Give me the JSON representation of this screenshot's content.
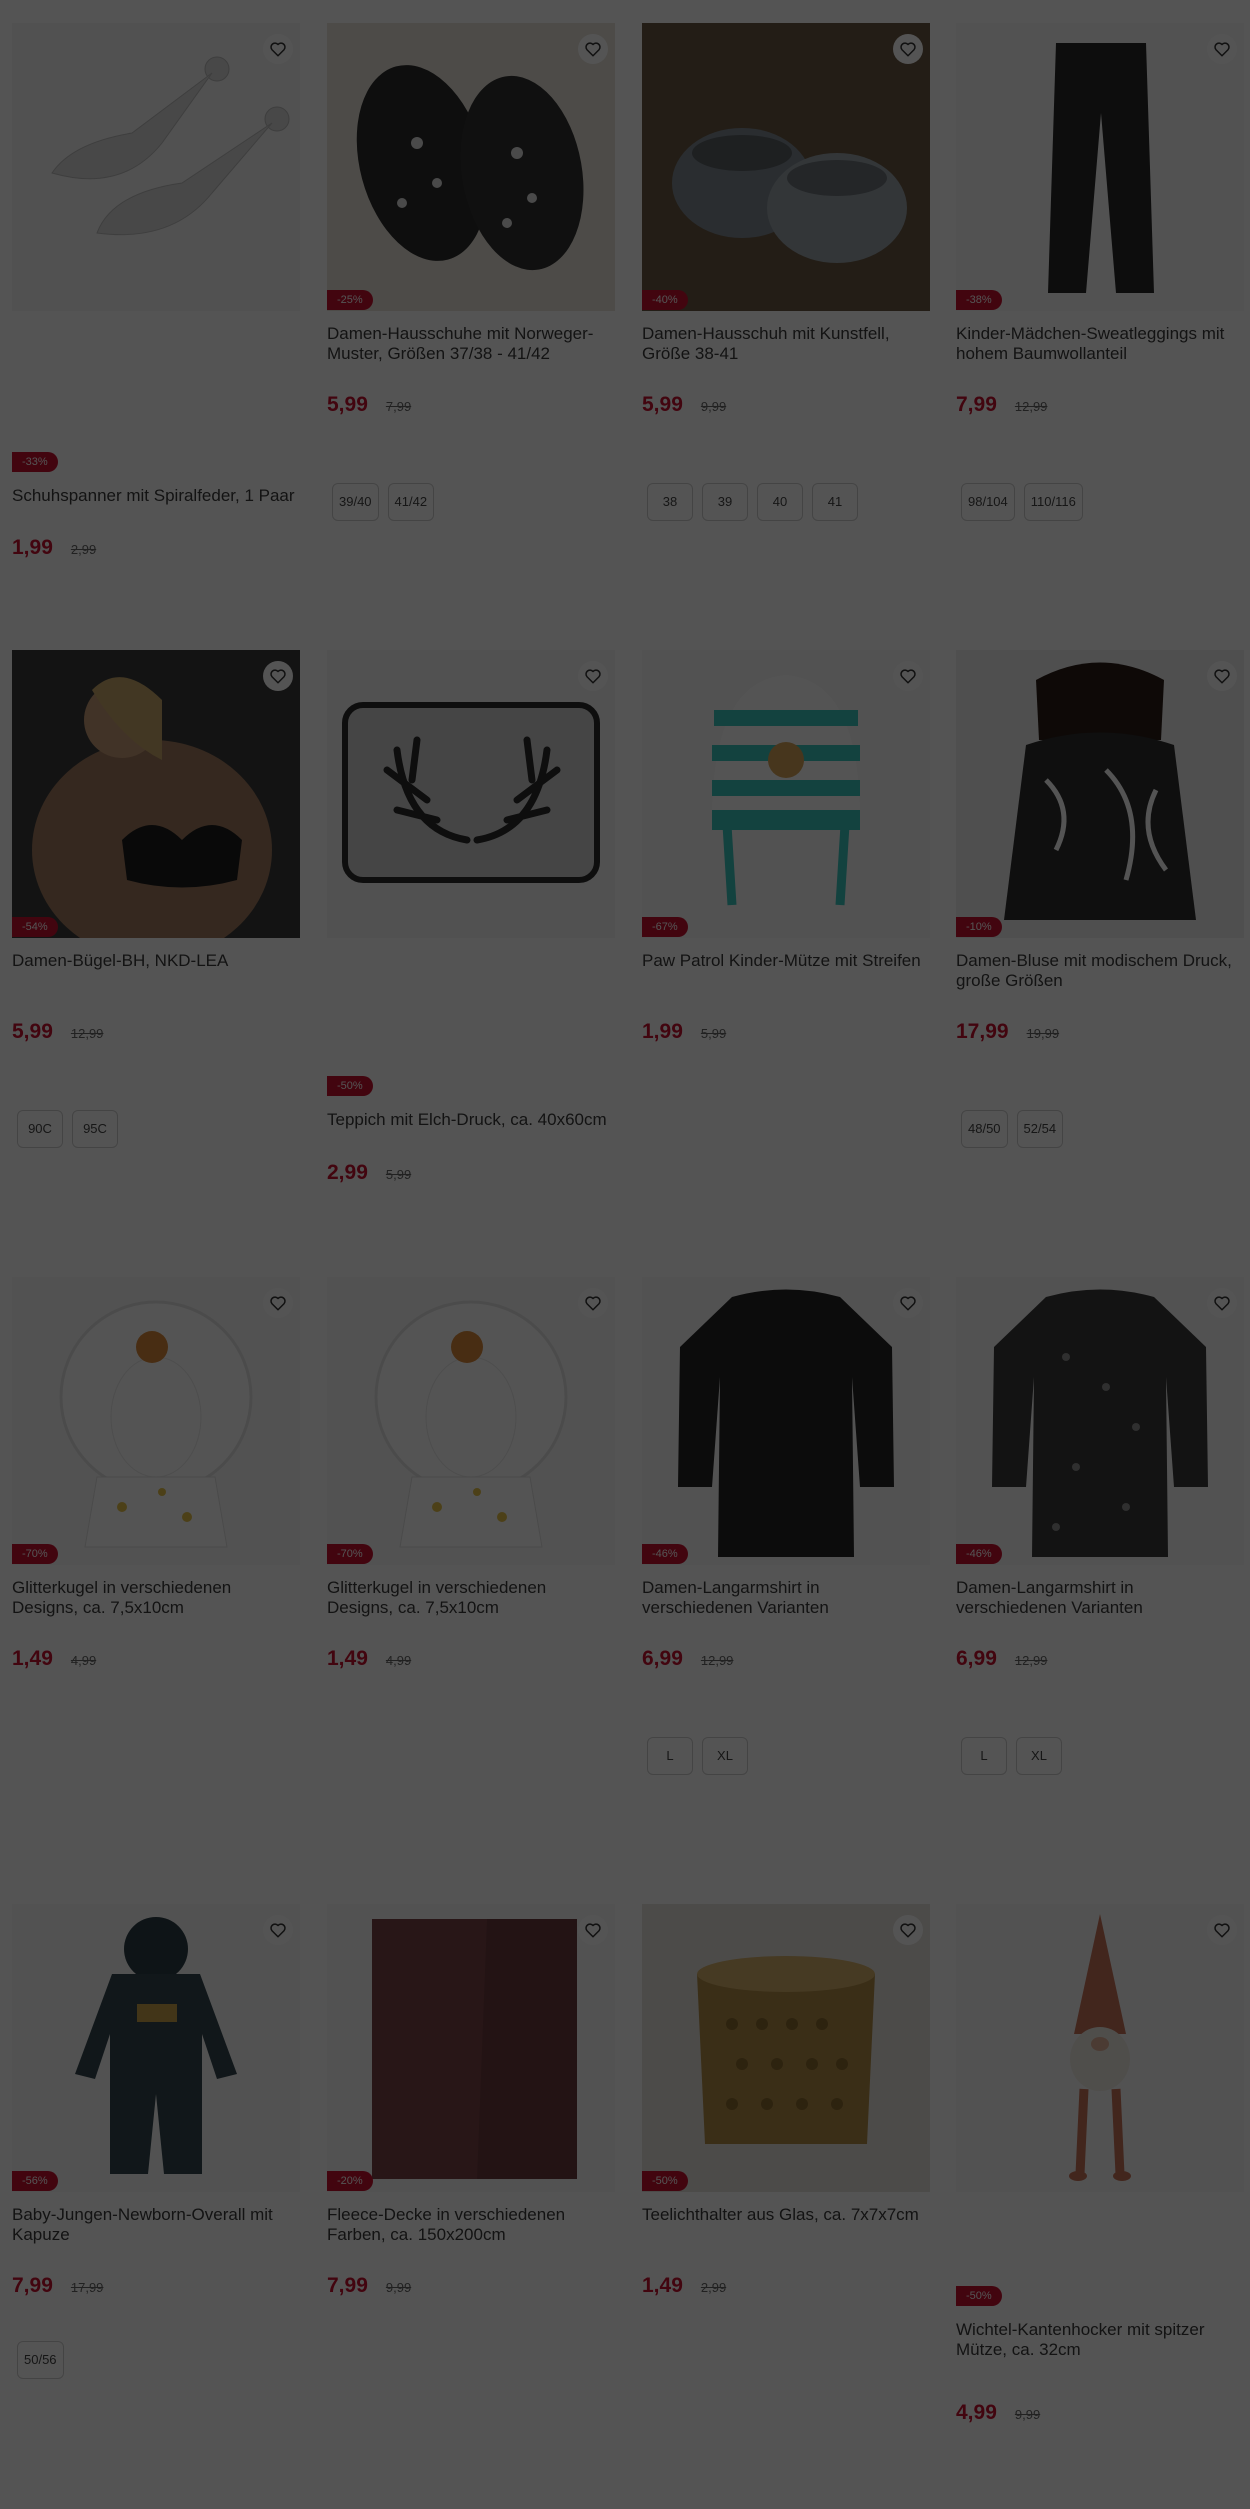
{
  "products": [
    {
      "name": "Schuhspanner mit Spiralfeder, 1 Paar",
      "discount": "-33%",
      "price": "1,99",
      "old_price": "2,99",
      "sizes": [],
      "image": "shoe-stretcher-image"
    },
    {
      "name": "Damen-Hausschuhe mit Norweger-Muster, Größen 37/38 - 41/42",
      "discount": "-25%",
      "price": "5,99",
      "old_price": "7,99",
      "sizes": [
        "39/40",
        "41/42"
      ],
      "image": "norwegian-slippers-image"
    },
    {
      "name": "Damen-Hausschuh mit Kunstfell, Größe 38-41",
      "discount": "-40%",
      "price": "5,99",
      "old_price": "9,99",
      "sizes": [
        "38",
        "39",
        "40",
        "41"
      ],
      "image": "faux-fur-slippers-image"
    },
    {
      "name": "Kinder-Mädchen-Sweatleggings mit hohem Baumwollanteil",
      "discount": "-38%",
      "price": "7,99",
      "old_price": "12,99",
      "sizes": [
        "98/104",
        "110/116"
      ],
      "image": "leggings-image"
    },
    {
      "name": "Damen-Bügel-BH, NKD-LEA",
      "discount": "-54%",
      "price": "5,99",
      "old_price": "12,99",
      "sizes": [
        "90C",
        "95C"
      ],
      "image": "bra-image"
    },
    {
      "name": "Teppich mit Elch-Druck, ca. 40x60cm",
      "discount": "-50%",
      "price": "2,99",
      "old_price": "5,99",
      "sizes": [],
      "image": "antler-rug-image"
    },
    {
      "name": "Paw Patrol Kinder-Mütze mit Streifen",
      "discount": "-67%",
      "price": "1,99",
      "old_price": "5,99",
      "sizes": [],
      "image": "kids-hat-image"
    },
    {
      "name": "Damen-Bluse mit modischem Druck, große Größen",
      "discount": "-10%",
      "price": "17,99",
      "old_price": "19,99",
      "sizes": [
        "48/50",
        "52/54"
      ],
      "image": "blouse-image"
    },
    {
      "name": "Glitterkugel in verschiedenen Designs, ca. 7,5x10cm",
      "discount": "-70%",
      "price": "1,49",
      "old_price": "4,99",
      "sizes": [],
      "image": "snow-globe-image"
    },
    {
      "name": "Glitterkugel in verschiedenen Designs, ca. 7,5x10cm",
      "discount": "-70%",
      "price": "1,49",
      "old_price": "4,99",
      "sizes": [],
      "image": "snow-globe-image"
    },
    {
      "name": "Damen-Langarmshirt in verschiedenen Varianten",
      "discount": "-46%",
      "price": "6,99",
      "old_price": "12,99",
      "sizes": [
        "L",
        "XL"
      ],
      "image": "longsleeve-dark-image"
    },
    {
      "name": "Damen-Langarmshirt in verschiedenen Varianten",
      "discount": "-46%",
      "price": "6,99",
      "old_price": "12,99",
      "sizes": [
        "L",
        "XL"
      ],
      "image": "longsleeve-pattern-image"
    },
    {
      "name": "Baby-Jungen-Newborn-Overall mit Kapuze",
      "discount": "-56%",
      "price": "7,99",
      "old_price": "17,99",
      "sizes": [
        "50/56"
      ],
      "image": "baby-overall-image"
    },
    {
      "name": "Fleece-Decke in verschiedenen Farben, ca. 150x200cm",
      "discount": "-20%",
      "price": "7,99",
      "old_price": "9,99",
      "sizes": [],
      "image": "fleece-blanket-image"
    },
    {
      "name": "Teelichthalter aus Glas, ca. 7x7x7cm",
      "discount": "-50%",
      "price": "1,49",
      "old_price": "2,99",
      "sizes": [],
      "image": "tealight-holder-image"
    },
    {
      "name": "Wichtel-Kantenhocker mit spitzer Mütze, ca. 32cm",
      "discount": "-50%",
      "price": "4,99",
      "old_price": "9,99",
      "sizes": [],
      "image": "gnome-image"
    }
  ],
  "colors": {
    "accent": "#c8102e",
    "overlay": "rgba(0,0,0,0.67)"
  }
}
